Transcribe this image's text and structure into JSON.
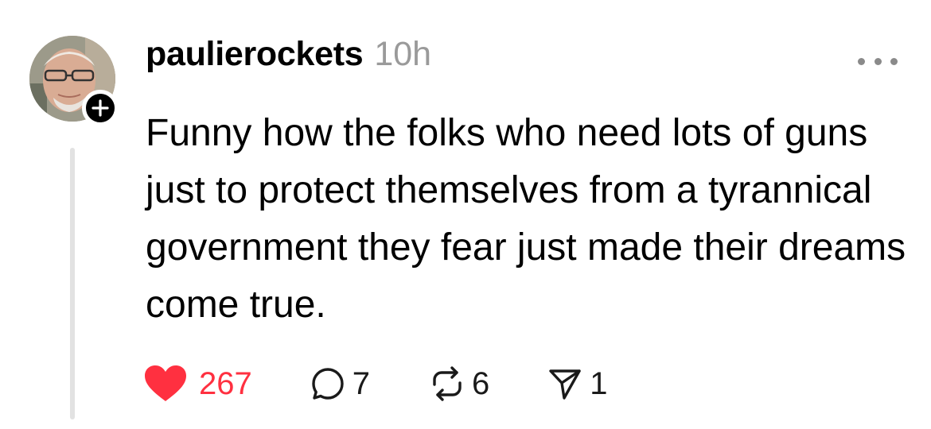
{
  "post": {
    "username": "paulierockets",
    "timestamp": "10h",
    "text": "Funny how the folks who need lots of guns just to protect themselves from a tyrannical government they fear just made their dreams come true.",
    "avatar_icon": "profile-photo",
    "follow_icon": "plus-icon",
    "more_icon": "more-horizontal-icon"
  },
  "actions": {
    "like": {
      "icon": "heart-filled-icon",
      "count": "267",
      "color": "#ff3040"
    },
    "reply": {
      "icon": "comment-icon",
      "count": "7"
    },
    "repost": {
      "icon": "repost-icon",
      "count": "6"
    },
    "share": {
      "icon": "send-icon",
      "count": "1"
    }
  }
}
